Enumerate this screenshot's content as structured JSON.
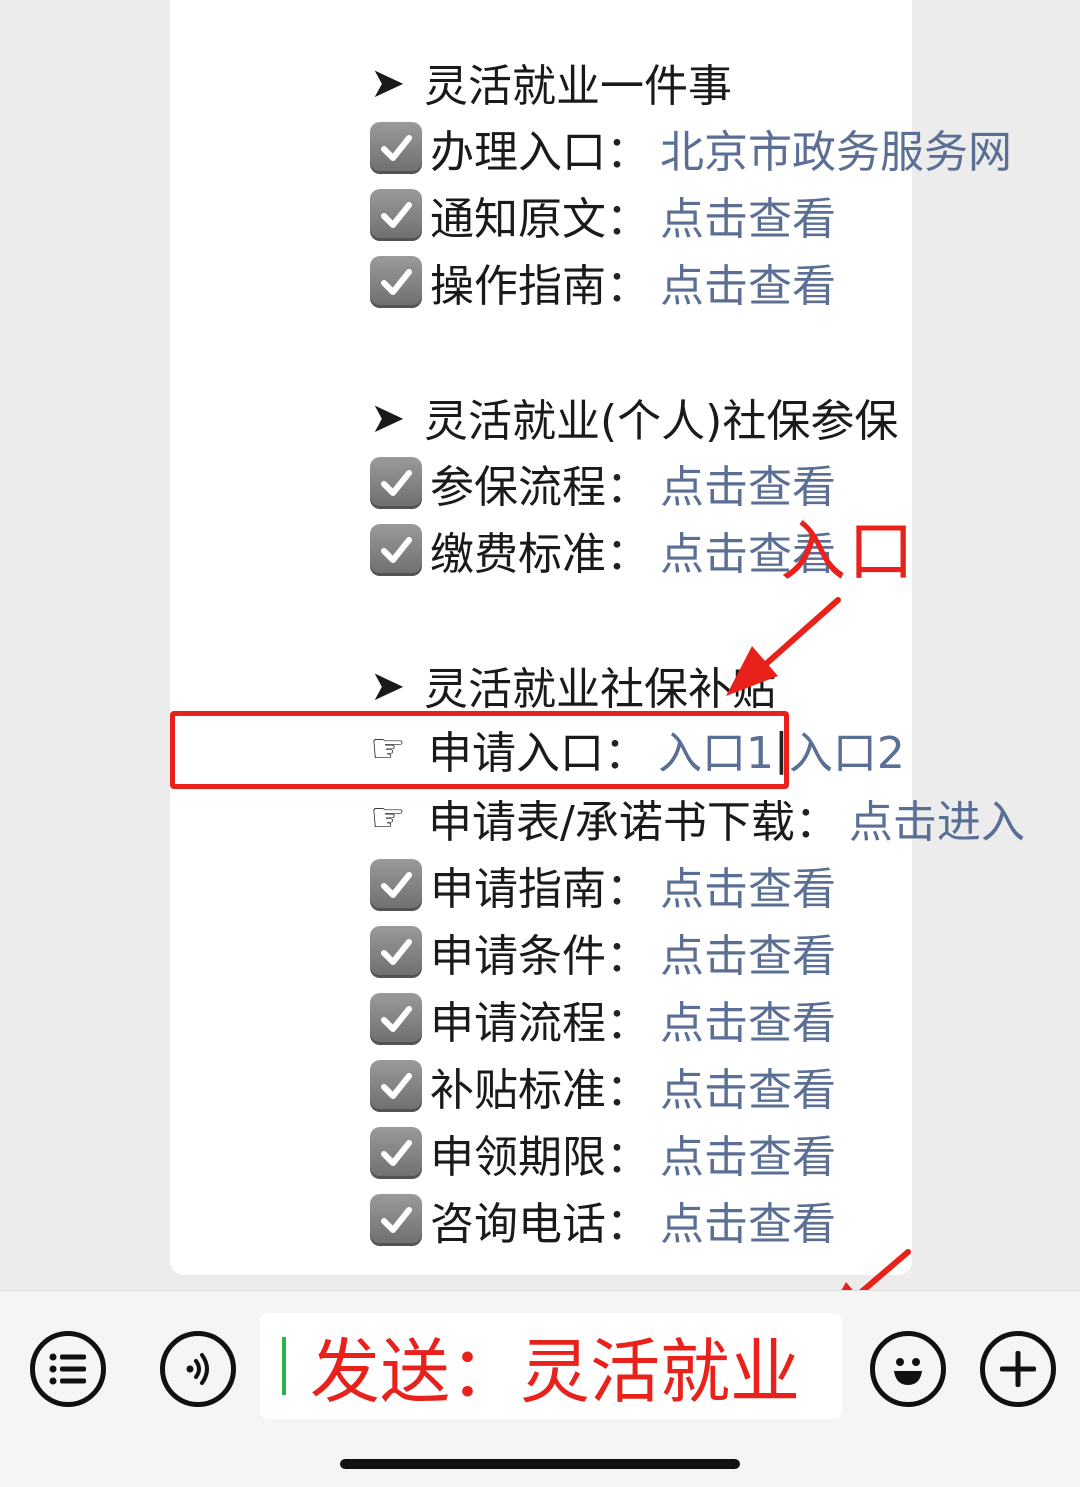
{
  "sections": [
    {
      "heading": "灵活就业一件事",
      "items": [
        {
          "label": "办理入口",
          "sep": "：",
          "link": "北京市政务服务网"
        },
        {
          "label": "通知原文",
          "sep": "：",
          "link": "点击查看"
        },
        {
          "label": "操作指南",
          "sep": "：",
          "link": "点击查看"
        }
      ]
    },
    {
      "heading": "灵活就业(个人)社保参保",
      "items": [
        {
          "label": "参保流程",
          "sep": "：",
          "link": "点击查看"
        },
        {
          "label": "缴费标准",
          "sep": "：",
          "link": "点击查看"
        }
      ]
    },
    {
      "heading": "灵活就业社保补贴",
      "apply_entry": {
        "label": "申请入口",
        "sep": "：",
        "link1": "入口1",
        "divider": "|",
        "link2": "入口2"
      },
      "download": {
        "label": "申请表/承诺书下载",
        "sep": "：",
        "link": "点击进入"
      },
      "items": [
        {
          "label": "申请指南",
          "sep": "：",
          "link": "点击查看"
        },
        {
          "label": "申请条件",
          "sep": "：",
          "link": "点击查看"
        },
        {
          "label": "申请流程",
          "sep": "：",
          "link": "点击查看"
        },
        {
          "label": "补贴标准",
          "sep": "：",
          "link": "点击查看"
        },
        {
          "label": "申领期限",
          "sep": "：",
          "link": "点击查看"
        },
        {
          "label": "咨询电话",
          "sep": "：",
          "link": "点击查看"
        }
      ]
    }
  ],
  "annotation": {
    "label": "入口",
    "color": "#e8221b"
  },
  "input_bar": {
    "text": "发送：灵活就业"
  },
  "icons": {
    "heading_bullet": "arrow-right-icon",
    "item_bullet": "checkbox-checked-icon",
    "pointer_bullet": "hand-pointing-right-icon",
    "menu": "list-menu-icon",
    "voice": "voice-icon",
    "emoji": "emoji-icon",
    "add": "plus-icon"
  },
  "colors": {
    "link": "#5b6f94",
    "annotation_red": "#e8221b",
    "caret_green": "#2bb24c"
  }
}
